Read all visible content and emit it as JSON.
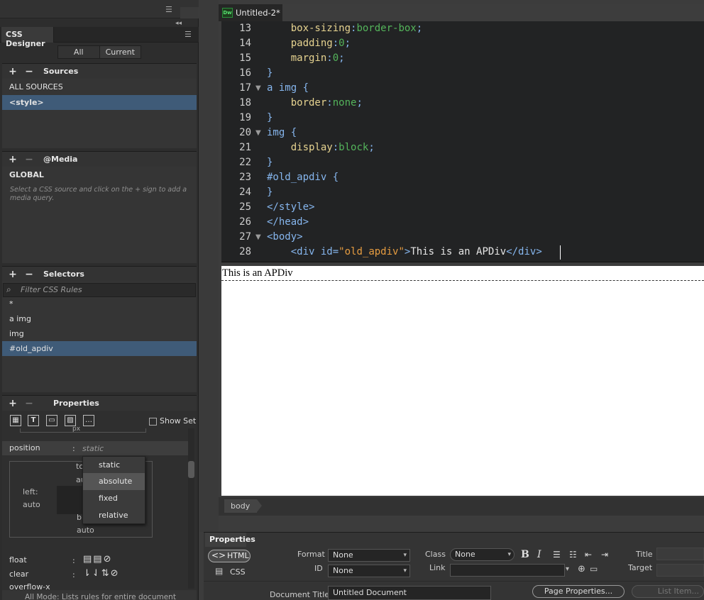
{
  "left_panel": {
    "tab": "CSS Designer",
    "view_toggle": {
      "all": "All",
      "current": "Current"
    },
    "sources": {
      "title": "Sources",
      "items": [
        "ALL SOURCES",
        "<style>"
      ]
    },
    "media": {
      "title": "@Media",
      "global": "GLOBAL",
      "hint": "Select a CSS source and click on the + sign to add a media query."
    },
    "selectors": {
      "title": "Selectors",
      "filter_placeholder": "Filter CSS Rules",
      "items": [
        "*",
        "a img",
        "img",
        "#old_apdiv"
      ]
    },
    "properties": {
      "title": "Properties",
      "show_set": "Show Set",
      "partial_unit": "px",
      "position_label": "position",
      "colon": ":",
      "position_value": "static",
      "boxmodel": {
        "top": "to",
        "top_val": "au",
        "left": "left:",
        "left_val": "auto",
        "bottom": "b",
        "bottom_val": "auto"
      },
      "dropdown": [
        "static",
        "absolute",
        "fixed",
        "relative"
      ],
      "float": "float",
      "clear": "clear",
      "overflow": "overflow-x",
      "status": "All Mode: Lists rules for entire document"
    }
  },
  "document": {
    "tab_title": "Untitled-2*",
    "logo": "Dw",
    "line_numbers": [
      "13",
      "14",
      "15",
      "16",
      "17",
      "18",
      "19",
      "20",
      "21",
      "22",
      "23",
      "24",
      "25",
      "26",
      "27",
      "28"
    ],
    "code": {
      "l13_prop": "box-sizing",
      "l13_val": "border-box",
      "l14_prop": "padding",
      "l14_val": "0",
      "l15_prop": "margin",
      "l15_val": "0",
      "close": "}",
      "l17": "a img {",
      "l18_prop": "border",
      "l18_val": "none",
      "l20": "img {",
      "l21_prop": "display",
      "l21_val": "block",
      "l23": "#old_apdiv {",
      "l25": "</style>",
      "l26": "</head>",
      "l27": "<body>",
      "l28_open": "<div ",
      "l28_attr": "id=",
      "l28_str": "\"old_apdiv\"",
      "l28_gt": ">",
      "l28_text": "This is an APDiv",
      "l28_close": "</div>"
    },
    "design_text": "This is an APDiv",
    "tag_selector": "body"
  },
  "properties_panel": {
    "tab": "Properties",
    "html_btn": "HTML",
    "css_btn": "CSS",
    "format_label": "Format",
    "format_value": "None",
    "id_label": "ID",
    "id_value": "None",
    "class_label": "Class",
    "class_value": "None",
    "link_label": "Link",
    "title_label": "Title",
    "target_label": "Target",
    "doc_title_label": "Document Title",
    "doc_title_value": "Untitled Document",
    "page_props": "Page Properties...",
    "list_item": "List Item..."
  }
}
